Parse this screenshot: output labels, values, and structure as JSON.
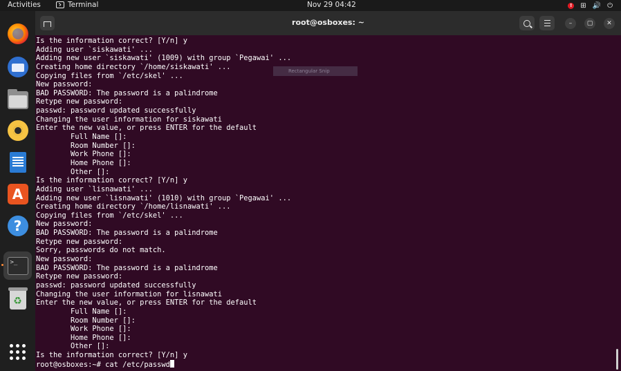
{
  "topbar": {
    "activities": "Activities",
    "app_name": "Terminal",
    "clock": "Nov 29  04:42",
    "tray_alert": "!",
    "tray_network": "⊞",
    "tray_volume": "🔊",
    "tray_power": "⏻"
  },
  "dock": {
    "items": [
      {
        "name": "Firefox",
        "icon": "firefox-icon"
      },
      {
        "name": "Thunderbird",
        "icon": "thunderbird-icon"
      },
      {
        "name": "Files",
        "icon": "files-icon"
      },
      {
        "name": "Rhythmbox",
        "icon": "rhythmbox-icon"
      },
      {
        "name": "LibreOffice Writer",
        "icon": "writer-icon"
      },
      {
        "name": "Ubuntu Software",
        "icon": "software-icon",
        "glyph": "A"
      },
      {
        "name": "Help",
        "icon": "help-icon",
        "glyph": "?"
      },
      {
        "name": "Terminal",
        "icon": "terminal-icon",
        "glyph": ">_"
      },
      {
        "name": "Trash",
        "icon": "trash-icon",
        "glyph": "♻"
      },
      {
        "name": "Show Applications",
        "icon": "app-grid-icon"
      }
    ],
    "accent": "#ff8c3a"
  },
  "window": {
    "title": "root@osboxes: ~",
    "min": "–",
    "max": "▢",
    "close": "✕"
  },
  "overlay": {
    "label": "Rectangular Snip"
  },
  "terminal": {
    "lines": [
      "Is the information correct? [Y/n] y",
      "Adding user `siskawati' ...",
      "Adding new user `siskawati' (1009) with group `Pegawai' ...",
      "Creating home directory `/home/siskawati' ...",
      "Copying files from `/etc/skel' ...",
      "New password:",
      "BAD PASSWORD: The password is a palindrome",
      "Retype new password:",
      "passwd: password updated successfully",
      "Changing the user information for siskawati",
      "Enter the new value, or press ENTER for the default",
      "        Full Name []:",
      "        Room Number []:",
      "        Work Phone []:",
      "        Home Phone []:",
      "        Other []:",
      "Is the information correct? [Y/n] y",
      "Adding user `lisnawati' ...",
      "Adding new user `lisnawati' (1010) with group `Pegawai' ...",
      "Creating home directory `/home/lisnawati' ...",
      "Copying files from `/etc/skel' ...",
      "New password:",
      "BAD PASSWORD: The password is a palindrome",
      "Retype new password:",
      "Sorry, passwords do not match.",
      "New password:",
      "BAD PASSWORD: The password is a palindrome",
      "Retype new password:",
      "passwd: password updated successfully",
      "Changing the user information for lisnawati",
      "Enter the new value, or press ENTER for the default",
      "        Full Name []:",
      "        Room Number []:",
      "        Work Phone []:",
      "        Home Phone []:",
      "        Other []:",
      "Is the information correct? [Y/n] y"
    ],
    "prompt": "root@osboxes:~# ",
    "command": "cat /etc/passwd",
    "background": "#300a24",
    "foreground": "#ffffff"
  }
}
